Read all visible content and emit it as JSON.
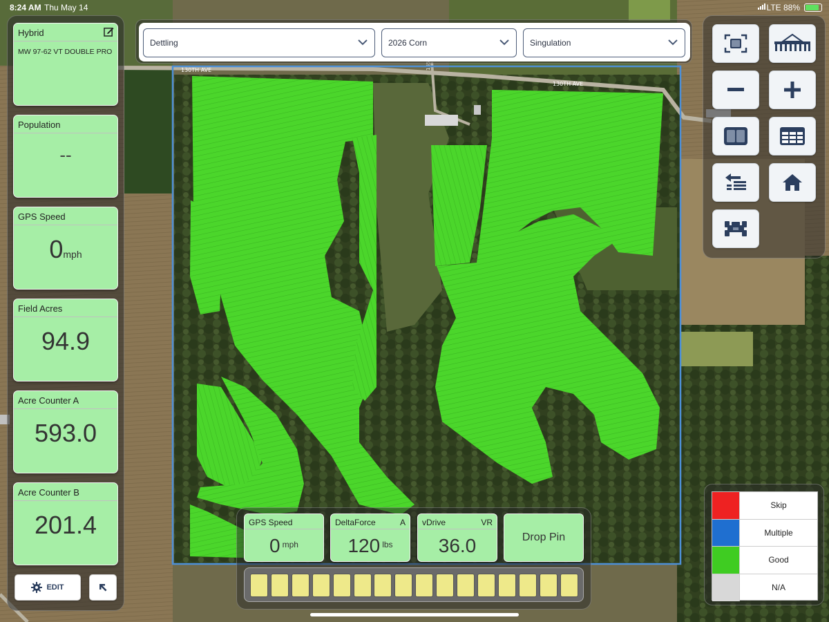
{
  "status_bar": {
    "time": "8:24 AM",
    "date": "Thu May 14",
    "network": "LTE 88%",
    "battery_level": 0.88
  },
  "map": {
    "road_labels": [
      "130TH AVE",
      "130TH AVE",
      "165"
    ],
    "boundary_color": "#4d8fd6",
    "coverage_color": "#4bd62b"
  },
  "left_panel": {
    "cards": [
      {
        "title": "Hybrid",
        "value": "MW 97-62 VT DOUBLE PRO",
        "icon": "edit-icon"
      },
      {
        "title": "Population",
        "value": "--"
      },
      {
        "title": "GPS Speed",
        "value": "0",
        "unit": "mph"
      },
      {
        "title": "Field Acres",
        "value": "94.9"
      },
      {
        "title": "Acre Counter A",
        "value": "593.0"
      },
      {
        "title": "Acre Counter B",
        "value": "201.4"
      }
    ],
    "edit_button": "EDIT"
  },
  "dropdowns": [
    {
      "value": "Dettling"
    },
    {
      "value": "2026 Corn"
    },
    {
      "value": "Singulation"
    }
  ],
  "tools": [
    {
      "name": "fit-view-icon"
    },
    {
      "name": "planter-icon"
    },
    {
      "name": "zoom-out-icon"
    },
    {
      "name": "zoom-in-icon"
    },
    {
      "name": "split-view-icon"
    },
    {
      "name": "table-view-icon"
    },
    {
      "name": "swap-icon"
    },
    {
      "name": "home-icon"
    },
    {
      "name": "tractor-icon"
    }
  ],
  "legend": [
    {
      "label": "Skip",
      "color": "#ee2222"
    },
    {
      "label": "Multiple",
      "color": "#1f6fd0"
    },
    {
      "label": "Good",
      "color": "#3fcc22"
    },
    {
      "label": "N/A",
      "color": "#d8d8d8"
    }
  ],
  "bottom_panel": {
    "metrics": [
      {
        "title": "GPS Speed",
        "tag": "",
        "value": "0",
        "unit": "mph"
      },
      {
        "title": "DeltaForce",
        "tag": "A",
        "value": "120",
        "unit": "lbs"
      },
      {
        "title": "vDrive",
        "tag": "VR",
        "value": "36.0",
        "unit": ""
      }
    ],
    "drop_pin": "Drop Pin",
    "row_count": 16,
    "row_color": "#eee98a"
  }
}
